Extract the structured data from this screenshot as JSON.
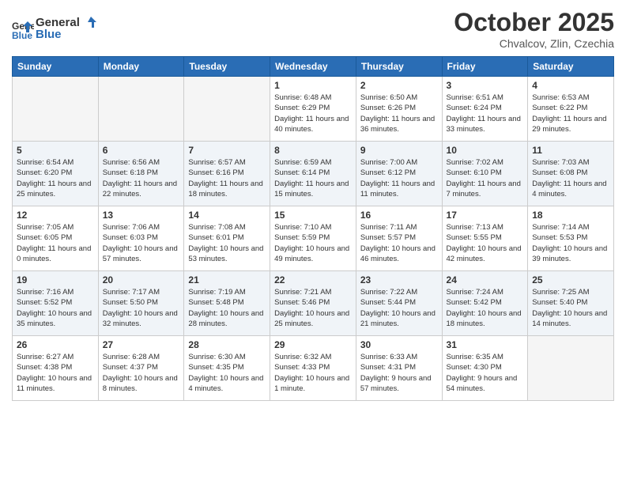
{
  "logo": {
    "general": "General",
    "blue": "Blue"
  },
  "header": {
    "month": "October 2025",
    "location": "Chvalcov, Zlin, Czechia"
  },
  "weekdays": [
    "Sunday",
    "Monday",
    "Tuesday",
    "Wednesday",
    "Thursday",
    "Friday",
    "Saturday"
  ],
  "weeks": [
    {
      "days": [
        {
          "num": "",
          "info": ""
        },
        {
          "num": "",
          "info": ""
        },
        {
          "num": "",
          "info": ""
        },
        {
          "num": "1",
          "info": "Sunrise: 6:48 AM\nSunset: 6:29 PM\nDaylight: 11 hours and 40 minutes."
        },
        {
          "num": "2",
          "info": "Sunrise: 6:50 AM\nSunset: 6:26 PM\nDaylight: 11 hours and 36 minutes."
        },
        {
          "num": "3",
          "info": "Sunrise: 6:51 AM\nSunset: 6:24 PM\nDaylight: 11 hours and 33 minutes."
        },
        {
          "num": "4",
          "info": "Sunrise: 6:53 AM\nSunset: 6:22 PM\nDaylight: 11 hours and 29 minutes."
        }
      ]
    },
    {
      "days": [
        {
          "num": "5",
          "info": "Sunrise: 6:54 AM\nSunset: 6:20 PM\nDaylight: 11 hours and 25 minutes."
        },
        {
          "num": "6",
          "info": "Sunrise: 6:56 AM\nSunset: 6:18 PM\nDaylight: 11 hours and 22 minutes."
        },
        {
          "num": "7",
          "info": "Sunrise: 6:57 AM\nSunset: 6:16 PM\nDaylight: 11 hours and 18 minutes."
        },
        {
          "num": "8",
          "info": "Sunrise: 6:59 AM\nSunset: 6:14 PM\nDaylight: 11 hours and 15 minutes."
        },
        {
          "num": "9",
          "info": "Sunrise: 7:00 AM\nSunset: 6:12 PM\nDaylight: 11 hours and 11 minutes."
        },
        {
          "num": "10",
          "info": "Sunrise: 7:02 AM\nSunset: 6:10 PM\nDaylight: 11 hours and 7 minutes."
        },
        {
          "num": "11",
          "info": "Sunrise: 7:03 AM\nSunset: 6:08 PM\nDaylight: 11 hours and 4 minutes."
        }
      ]
    },
    {
      "days": [
        {
          "num": "12",
          "info": "Sunrise: 7:05 AM\nSunset: 6:05 PM\nDaylight: 11 hours and 0 minutes."
        },
        {
          "num": "13",
          "info": "Sunrise: 7:06 AM\nSunset: 6:03 PM\nDaylight: 10 hours and 57 minutes."
        },
        {
          "num": "14",
          "info": "Sunrise: 7:08 AM\nSunset: 6:01 PM\nDaylight: 10 hours and 53 minutes."
        },
        {
          "num": "15",
          "info": "Sunrise: 7:10 AM\nSunset: 5:59 PM\nDaylight: 10 hours and 49 minutes."
        },
        {
          "num": "16",
          "info": "Sunrise: 7:11 AM\nSunset: 5:57 PM\nDaylight: 10 hours and 46 minutes."
        },
        {
          "num": "17",
          "info": "Sunrise: 7:13 AM\nSunset: 5:55 PM\nDaylight: 10 hours and 42 minutes."
        },
        {
          "num": "18",
          "info": "Sunrise: 7:14 AM\nSunset: 5:53 PM\nDaylight: 10 hours and 39 minutes."
        }
      ]
    },
    {
      "days": [
        {
          "num": "19",
          "info": "Sunrise: 7:16 AM\nSunset: 5:52 PM\nDaylight: 10 hours and 35 minutes."
        },
        {
          "num": "20",
          "info": "Sunrise: 7:17 AM\nSunset: 5:50 PM\nDaylight: 10 hours and 32 minutes."
        },
        {
          "num": "21",
          "info": "Sunrise: 7:19 AM\nSunset: 5:48 PM\nDaylight: 10 hours and 28 minutes."
        },
        {
          "num": "22",
          "info": "Sunrise: 7:21 AM\nSunset: 5:46 PM\nDaylight: 10 hours and 25 minutes."
        },
        {
          "num": "23",
          "info": "Sunrise: 7:22 AM\nSunset: 5:44 PM\nDaylight: 10 hours and 21 minutes."
        },
        {
          "num": "24",
          "info": "Sunrise: 7:24 AM\nSunset: 5:42 PM\nDaylight: 10 hours and 18 minutes."
        },
        {
          "num": "25",
          "info": "Sunrise: 7:25 AM\nSunset: 5:40 PM\nDaylight: 10 hours and 14 minutes."
        }
      ]
    },
    {
      "days": [
        {
          "num": "26",
          "info": "Sunrise: 6:27 AM\nSunset: 4:38 PM\nDaylight: 10 hours and 11 minutes."
        },
        {
          "num": "27",
          "info": "Sunrise: 6:28 AM\nSunset: 4:37 PM\nDaylight: 10 hours and 8 minutes."
        },
        {
          "num": "28",
          "info": "Sunrise: 6:30 AM\nSunset: 4:35 PM\nDaylight: 10 hours and 4 minutes."
        },
        {
          "num": "29",
          "info": "Sunrise: 6:32 AM\nSunset: 4:33 PM\nDaylight: 10 hours and 1 minute."
        },
        {
          "num": "30",
          "info": "Sunrise: 6:33 AM\nSunset: 4:31 PM\nDaylight: 9 hours and 57 minutes."
        },
        {
          "num": "31",
          "info": "Sunrise: 6:35 AM\nSunset: 4:30 PM\nDaylight: 9 hours and 54 minutes."
        },
        {
          "num": "",
          "info": ""
        }
      ]
    }
  ]
}
